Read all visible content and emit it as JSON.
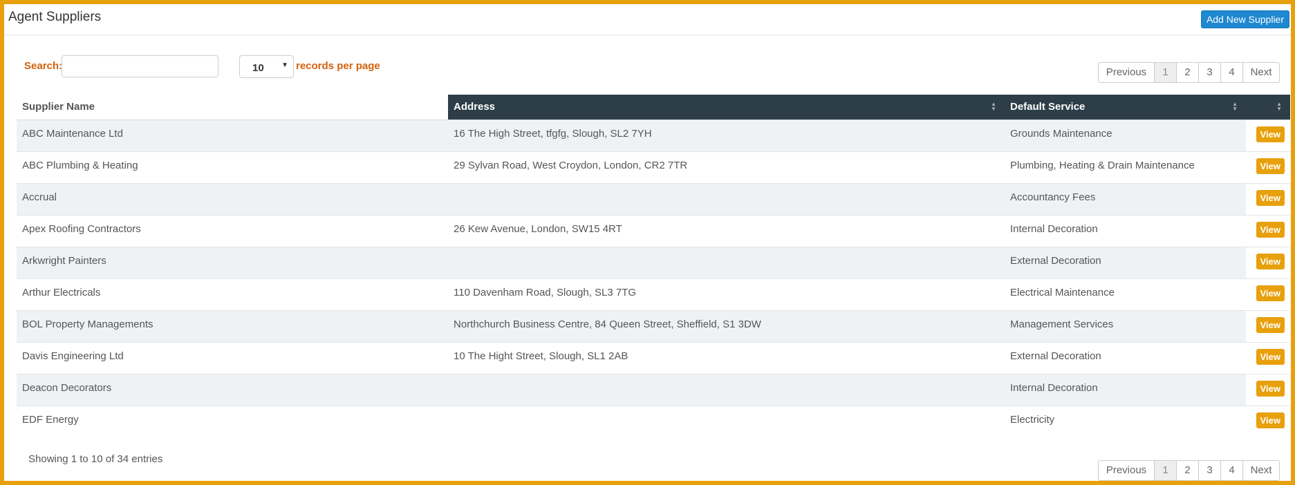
{
  "header": {
    "title": "Agent Suppliers",
    "add_button": "Add New Supplier"
  },
  "controls": {
    "search_label": "Search:",
    "search_value": "",
    "per_page_value": "10",
    "records_label": "records per page"
  },
  "pagination": {
    "previous": "Previous",
    "pages": [
      "1",
      "2",
      "3",
      "4"
    ],
    "active_page": "1",
    "next": "Next"
  },
  "table": {
    "columns": [
      "Supplier Name",
      "Address",
      "Default Service",
      ""
    ],
    "rows": [
      {
        "name": "ABC Maintenance Ltd",
        "address": "16 The High Street, tfgfg, Slough, SL2 7YH",
        "service": "Grounds Maintenance",
        "action": "View"
      },
      {
        "name": "ABC Plumbing & Heating",
        "address": "29 Sylvan Road, West Croydon, London, CR2 7TR",
        "service": "Plumbing, Heating & Drain Maintenance",
        "action": "View"
      },
      {
        "name": "Accrual",
        "address": "",
        "service": "Accountancy Fees",
        "action": "View"
      },
      {
        "name": "Apex Roofing Contractors",
        "address": "26 Kew Avenue, London, SW15 4RT",
        "service": "Internal Decoration",
        "action": "View"
      },
      {
        "name": "Arkwright Painters",
        "address": "",
        "service": "External Decoration",
        "action": "View"
      },
      {
        "name": "Arthur Electricals",
        "address": "110 Davenham Road, Slough, SL3 7TG",
        "service": "Electrical Maintenance",
        "action": "View"
      },
      {
        "name": "BOL Property Managements",
        "address": "Northchurch Business Centre, 84 Queen Street, Sheffield, S1 3DW",
        "service": "Management Services",
        "action": "View"
      },
      {
        "name": "Davis Engineering Ltd",
        "address": "10 The Hight Street, Slough, SL1 2AB",
        "service": "External Decoration",
        "action": "View"
      },
      {
        "name": "Deacon Decorators",
        "address": "",
        "service": "Internal Decoration",
        "action": "View"
      },
      {
        "name": "EDF Energy",
        "address": "",
        "service": "Electricity",
        "action": "View"
      }
    ]
  },
  "footer": {
    "showing": "Showing 1 to 10 of 34 entries"
  },
  "colors": {
    "frame": "#e8a00c",
    "accent_orange": "#d4610a",
    "primary_button": "#1e88d0",
    "header_dark": "#2d3e48"
  }
}
